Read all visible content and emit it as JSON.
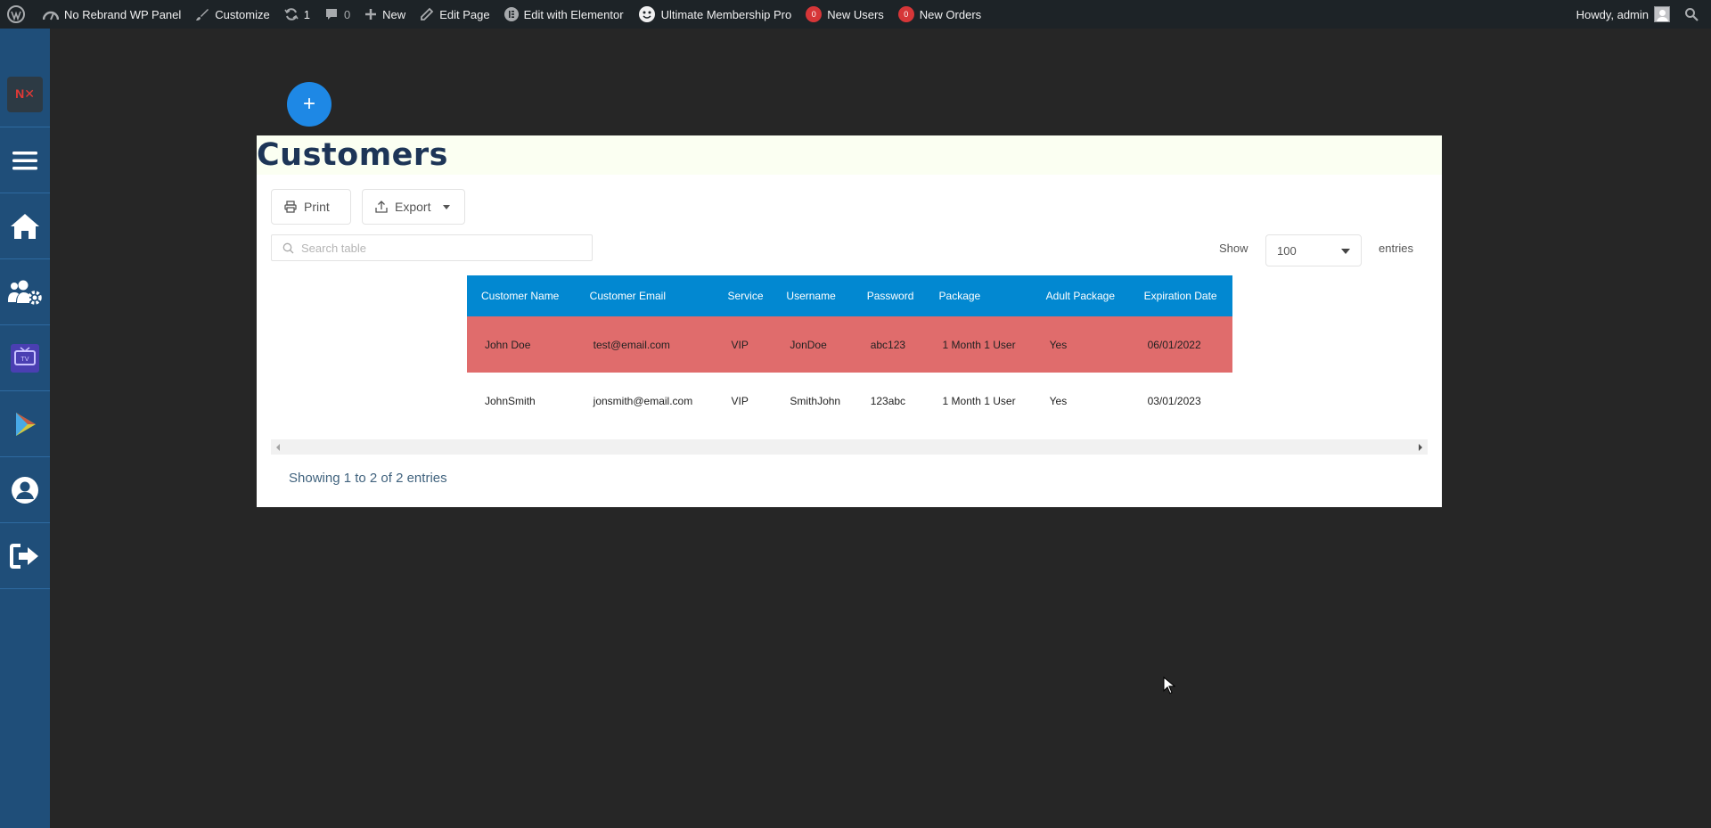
{
  "adminbar": {
    "site_name": "No Rebrand WP Panel",
    "customize": "Customize",
    "updates_count": "1",
    "comments_count": "0",
    "new": "New",
    "edit_page": "Edit Page",
    "edit_elementor": "Edit with Elementor",
    "membership": "Ultimate Membership Pro",
    "new_users_count": "0",
    "new_users": "New Users",
    "new_orders_count": "0",
    "new_orders": "New Orders",
    "howdy": "Howdy, admin"
  },
  "sidebar": {
    "logo": "N✕",
    "items": [
      "menu-icon",
      "home-icon",
      "users-cog-icon",
      "tv-icon",
      "play-icon",
      "user-icon",
      "logout-icon"
    ]
  },
  "page": {
    "title": "Customers",
    "add_button": "+",
    "print_label": "Print",
    "export_label": "Export",
    "search_placeholder": "Search table",
    "show_label": "Show",
    "entries_value": "100",
    "entries_label": "entries",
    "info": "Showing 1 to 2 of 2 entries"
  },
  "table": {
    "headers": [
      "Customer Name",
      "Customer Email",
      "Service",
      "Username",
      "Password",
      "Package",
      "Adult Package",
      "Expiration Date"
    ],
    "rows": [
      [
        "John Doe",
        "test@email.com",
        "VIP",
        "JonDoe",
        "abc123",
        "1 Month 1 User",
        "Yes",
        "06/01/2022"
      ],
      [
        "JohnSmith",
        "jonsmith@email.com",
        "VIP",
        "SmithJohn",
        "123abc",
        "1 Month 1 User",
        "Yes",
        "03/01/2023"
      ]
    ]
  },
  "colors": {
    "adminbar": "#1d2327",
    "sidebar": "#1f4e79",
    "table_header": "#0288d1",
    "expired_row": "#e06c6c",
    "title": "#1d3557",
    "fab": "#1e88e5"
  }
}
